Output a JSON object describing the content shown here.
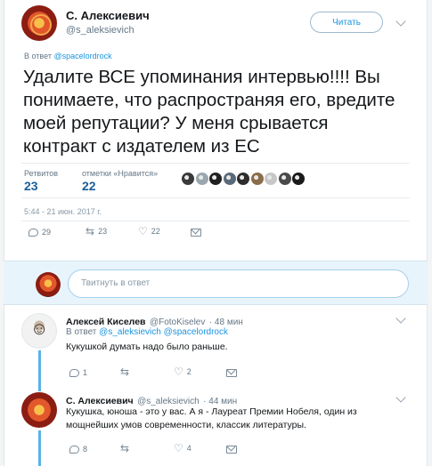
{
  "main_tweet": {
    "author_name": "С. Алексиевич",
    "author_handle": "@s_aleksievich",
    "follow_label": "Читать",
    "reply_prefix": "В ответ",
    "reply_handle": "@spacelordrock",
    "text": "Удалите ВСЕ упоминания интервью!!!! Вы понимаете, что распространяя его, вредите моей репутации? У меня срывается контракт с издателем из ЕС",
    "retweets_label": "Ретвитов",
    "retweets_count": "23",
    "likes_label": "отметки «Нравится»",
    "likes_count": "22",
    "timestamp": "5:44 - 21 июн. 2017 г.",
    "actions": {
      "reply_count": "29",
      "retweet_count": "23",
      "like_count": "22"
    }
  },
  "reply_box": {
    "placeholder": "Твитнуть в ответ"
  },
  "replies": [
    {
      "author_name": "Алексей Киселев",
      "author_handle": "@FotoKiselev",
      "time": "· 48 мин",
      "reply_prefix": "В ответ",
      "reply_handles": "@s_aleksievich @spacelordrock",
      "text": "Кукушкой думать надо было раньше.",
      "reply_count": "1",
      "retweet_count": "",
      "like_count": "2"
    },
    {
      "author_name": "С. Алексиевич",
      "author_handle": "@s_aleksievich",
      "time": "· 44 мин",
      "text": "Кукушка, юноша - это у вас. А я - Лауреат Премии Нобеля, один из мощнейших умов современности, классик литературы.",
      "reply_count": "8",
      "retweet_count": "",
      "like_count": "4"
    }
  ],
  "colors": {
    "accent": "#1b95e0",
    "thread_line": "#58b2e8",
    "muted": "#657786",
    "reply_area_bg": "#e8f4fb"
  },
  "likers_avatar_colors": [
    "#3a3a3a",
    "#9aa7b0",
    "#202020",
    "#5b6a78",
    "#2d2d2d",
    "#8a6d4a",
    "#c7c7c7",
    "#4a4a4a",
    "#1a1a1a"
  ]
}
